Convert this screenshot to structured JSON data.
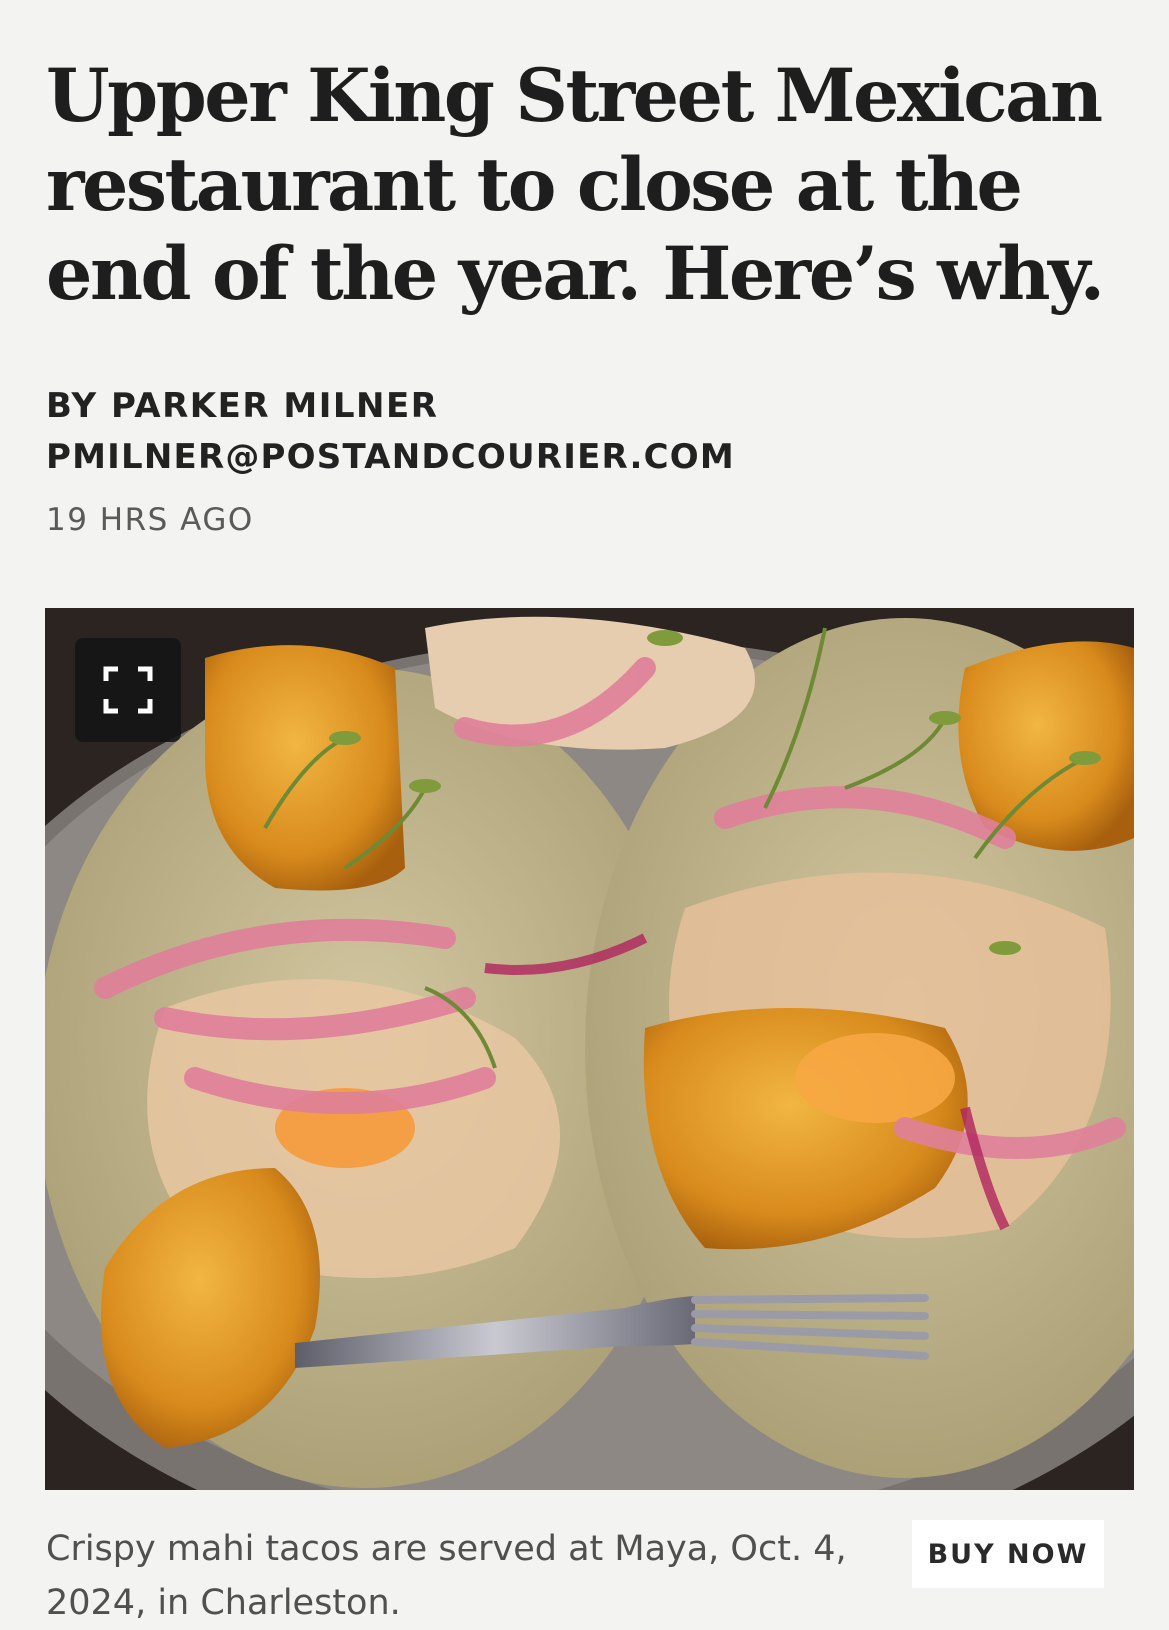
{
  "article": {
    "headline": "Upper King Street Mexican restaurant to close at the end of the year. Here’s why.",
    "byline": "BY PARKER MILNER",
    "email": "PMILNER@POSTANDCOURIER.COM",
    "timestamp": "19 HRS AGO"
  },
  "photo": {
    "expand_icon": "fullscreen-expand-icon",
    "caption": "Crispy mahi tacos are served at Maya, Oct. 4, 2024, in Charleston.",
    "buy_label": "BUY NOW"
  }
}
